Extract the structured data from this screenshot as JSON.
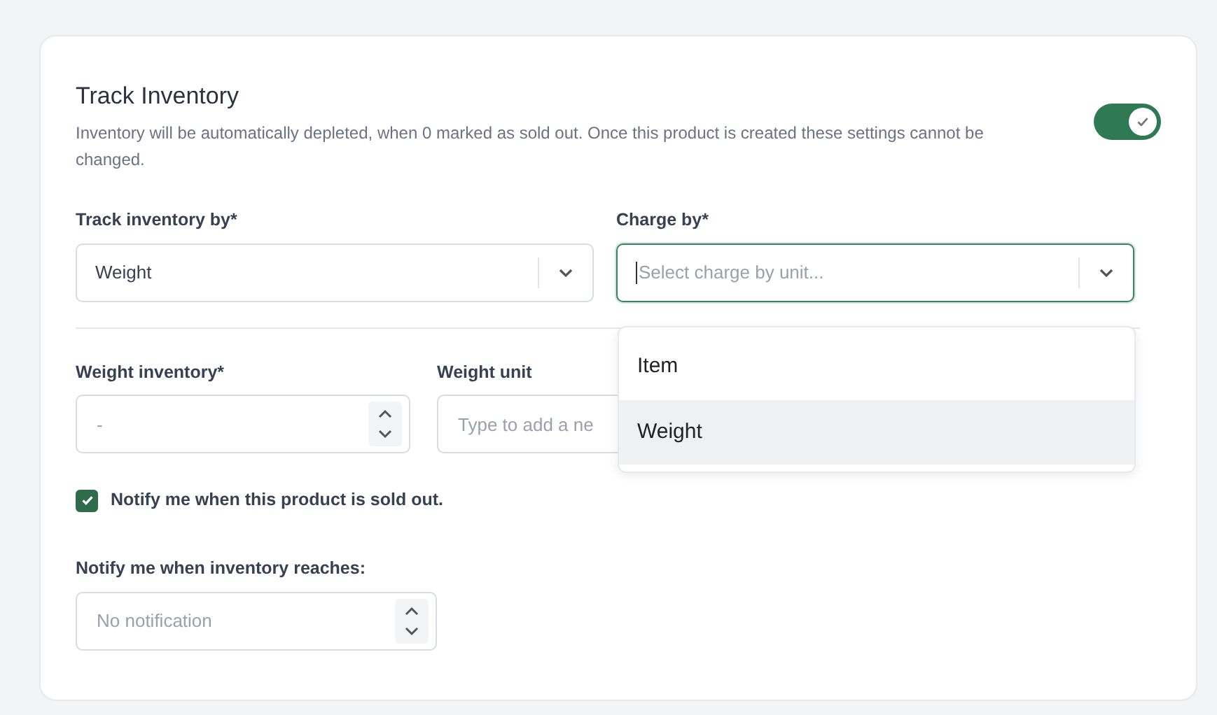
{
  "section": {
    "title": "Track Inventory",
    "description": "Inventory will be automatically depleted, when 0 marked as sold out. Once this product is created these settings cannot be changed.",
    "enabled": true
  },
  "track_by": {
    "label": "Track inventory by*",
    "value": "Weight"
  },
  "charge_by": {
    "label": "Charge by*",
    "placeholder": "Select charge by unit...",
    "focused": true,
    "options": [
      {
        "label": "Item",
        "selected": false
      },
      {
        "label": "Weight",
        "selected": true
      }
    ]
  },
  "weight_inventory": {
    "label": "Weight inventory*",
    "placeholder": "-"
  },
  "weight_unit": {
    "label": "Weight unit",
    "placeholder": "Type to add a ne"
  },
  "notify_sold_out": {
    "label": "Notify me when this product is sold out.",
    "checked": true
  },
  "notify_threshold": {
    "label": "Notify me when inventory reaches:",
    "placeholder": "No notification"
  }
}
